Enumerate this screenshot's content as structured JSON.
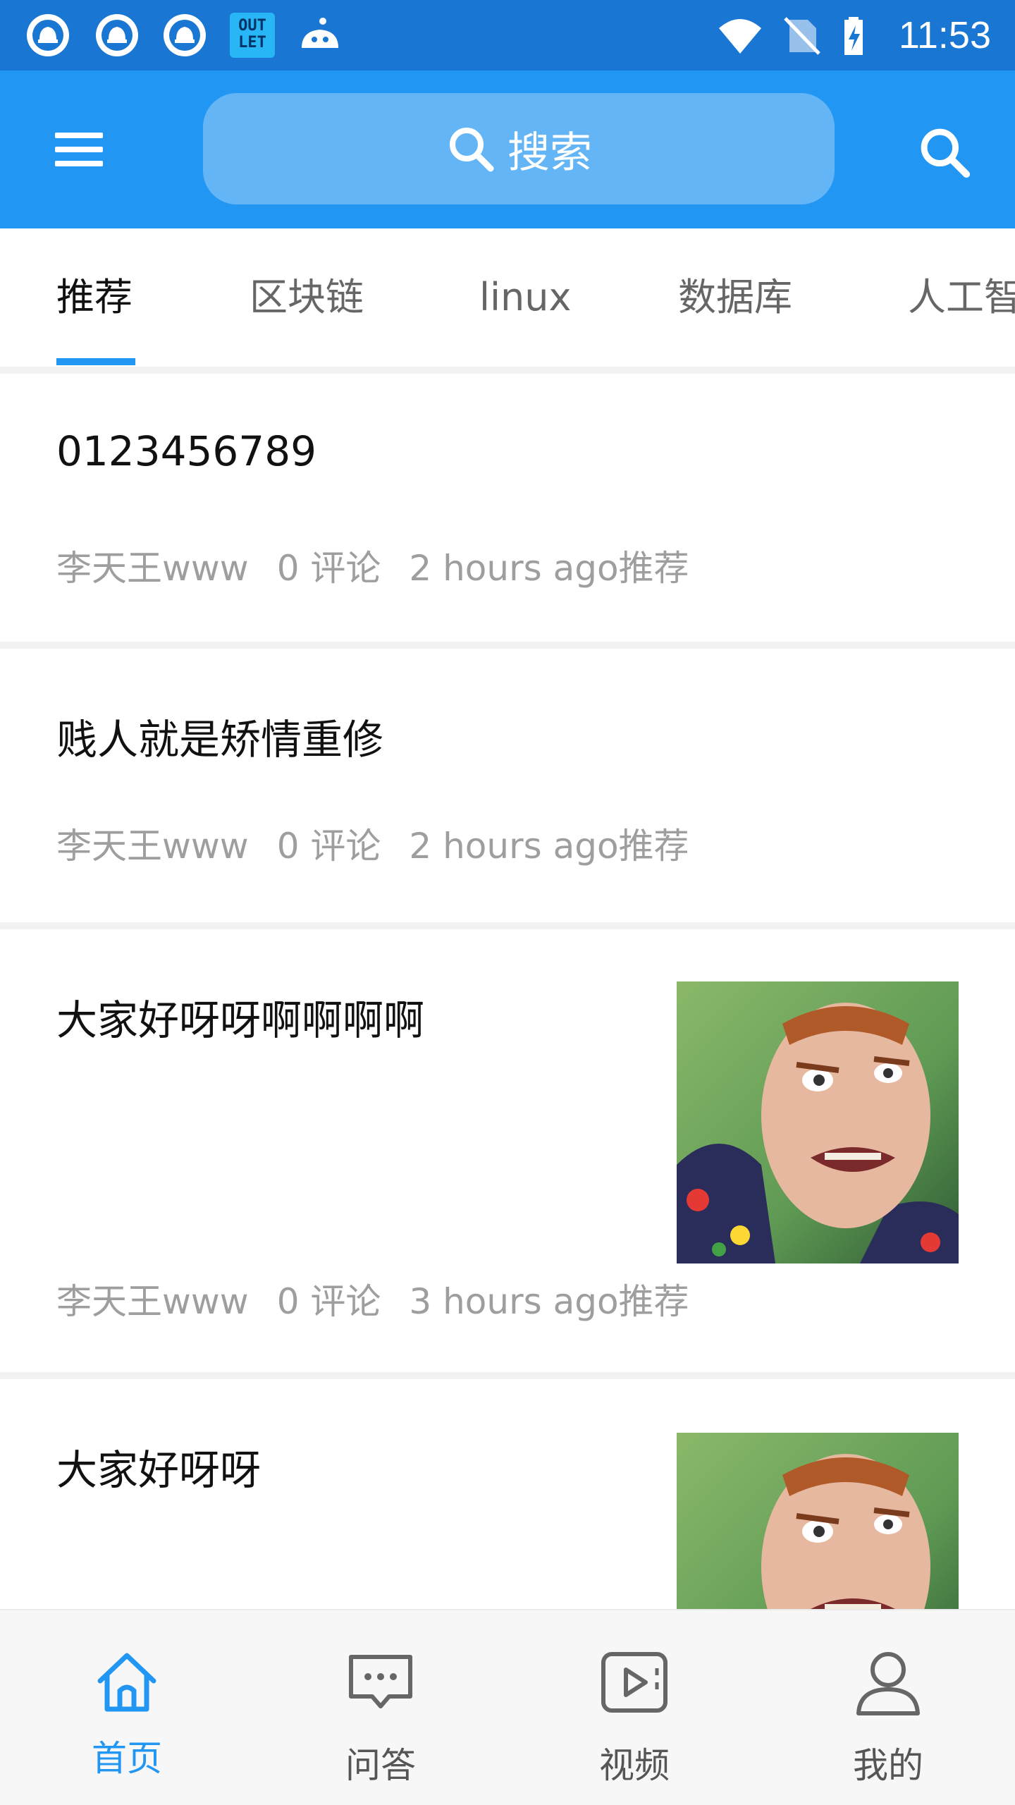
{
  "status_bar": {
    "time": "11:53",
    "notification_icons": [
      "app-notification-icon",
      "app-notification-icon",
      "app-notification-icon",
      "outlet-app-icon",
      "cloud-app-icon"
    ],
    "system_icons": [
      "wifi-icon",
      "no-sim-icon",
      "battery-charging-icon"
    ],
    "outlet_text": "OUT LET"
  },
  "app_bar": {
    "search_placeholder": "搜索",
    "menu_icon": "hamburger-menu-icon",
    "search_icon": "search-icon"
  },
  "tabs": [
    {
      "label": "推荐",
      "active": true
    },
    {
      "label": "区块链",
      "active": false
    },
    {
      "label": "linux",
      "active": false
    },
    {
      "label": "数据库",
      "active": false
    },
    {
      "label": "人工智能",
      "active": false
    }
  ],
  "feed": [
    {
      "title": "0123456789",
      "author": "李天王www",
      "comments": "0 评论",
      "time": "2 hours ago推荐",
      "has_image": false
    },
    {
      "title": "贱人就是矫情重修",
      "author": "李天王www",
      "comments": "0 评论",
      "time": "2 hours ago推荐",
      "has_image": false
    },
    {
      "title": "大家好呀呀啊啊啊啊",
      "author": "李天王www",
      "comments": "0 评论",
      "time": "3 hours ago推荐",
      "has_image": true
    },
    {
      "title": "大家好呀呀",
      "has_image": true
    }
  ],
  "bottom_nav": [
    {
      "label": "首页",
      "icon": "home-icon",
      "active": true
    },
    {
      "label": "问答",
      "icon": "chat-bubble-icon",
      "active": false
    },
    {
      "label": "视频",
      "icon": "video-play-icon",
      "active": false
    },
    {
      "label": "我的",
      "icon": "person-icon",
      "active": false
    }
  ],
  "colors": {
    "primary": "#2196f3",
    "status_bar": "#1976d2",
    "search_box": "#64b5f6",
    "meta_text": "#9e9e9e"
  }
}
